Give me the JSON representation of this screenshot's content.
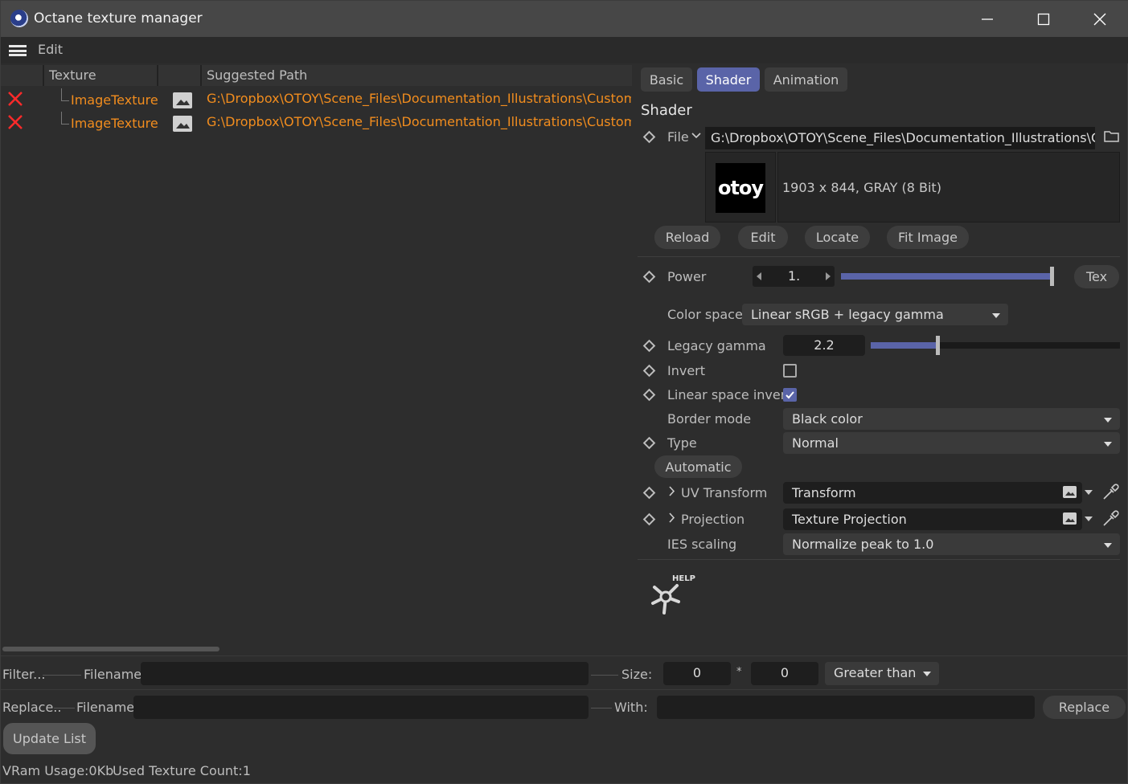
{
  "window": {
    "title": "Octane texture manager"
  },
  "menu": {
    "edit": "Edit"
  },
  "table": {
    "headers": [
      "Texture",
      "Suggested Path"
    ],
    "rows": [
      {
        "name": "ImageTexture",
        "path": "G:\\Dropbox\\OTOY\\Scene_Files\\Documentation_Illustrations\\Custom_AOV"
      },
      {
        "name": "ImageTexture",
        "path": "G:\\Dropbox\\OTOY\\Scene_Files\\Documentation_Illustrations\\Custom_AOV"
      }
    ]
  },
  "tabs": [
    "Basic",
    "Shader",
    "Animation"
  ],
  "shader": {
    "section": "Shader",
    "file_label": "File",
    "file_path": "G:\\Dropbox\\OTOY\\Scene_Files\\Documentation_Illustrations\\Custom",
    "thumb_logo": "otoy",
    "image_info": "1903 x 844, GRAY (8 Bit)",
    "buttons": [
      "Reload",
      "Edit",
      "Locate",
      "Fit Image"
    ],
    "power_label": "Power",
    "power_value": "1.",
    "power_fraction": 1.0,
    "tex_button": "Tex",
    "colorspace_label": "Color space",
    "colorspace_value": "Linear sRGB + legacy gamma",
    "gamma_label": "Legacy gamma",
    "gamma_value": "2.2",
    "gamma_fraction": 0.27,
    "invert_label": "Invert",
    "invert_checked": false,
    "linear_invert_label": "Linear space invert",
    "linear_invert_checked": true,
    "border_label": "Border mode",
    "border_value": "Black color",
    "type_label": "Type",
    "type_value": "Normal",
    "automatic_button": "Automatic",
    "uv_label": "UV Transform",
    "uv_value": "Transform",
    "proj_label": "Projection",
    "proj_value": "Texture Projection",
    "ies_label": "IES scaling",
    "ies_value": "Normalize peak to 1.0",
    "help_label": "HELP"
  },
  "filter": {
    "label": "Filter...",
    "filename_label": "Filename",
    "filename_value": "",
    "size_label": "Size:",
    "size_w": "0",
    "size_sep": "*",
    "size_h": "0",
    "compare": "Greater than"
  },
  "replace": {
    "label": "Replace..",
    "filename_label": "Filename",
    "filename_value": "",
    "with_label": "With:",
    "with_value": "",
    "button": "Replace"
  },
  "update_button": "Update List",
  "status": {
    "vram": "VRam Usage:0Kb",
    "count": "Used Texture Count:1"
  },
  "colors": {
    "accent": "#5a64a8",
    "path": "#f28d1e",
    "error": "#ff2a2a"
  }
}
